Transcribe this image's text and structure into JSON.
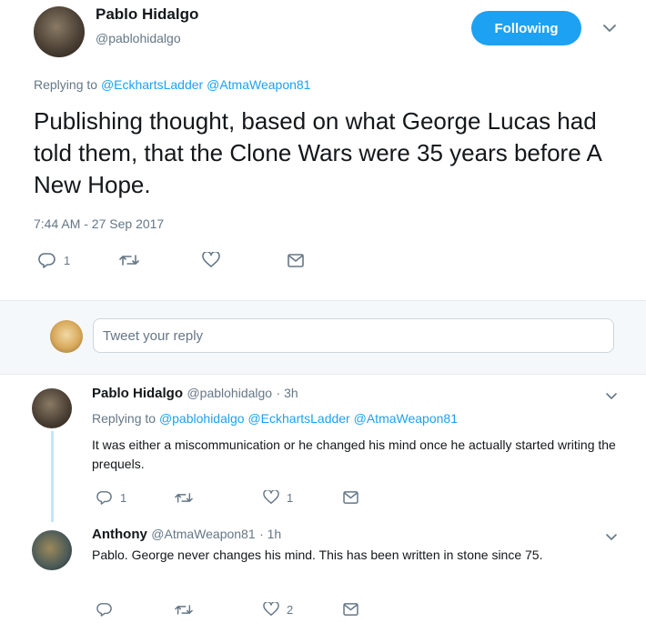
{
  "main_tweet": {
    "author_name": "Pablo Hidalgo",
    "author_handle": "@pablohidalgo",
    "follow_label": "Following",
    "replying_prefix": "Replying to",
    "replying_to": [
      "@EckhartsLadder",
      "@AtmaWeapon81"
    ],
    "text": "Publishing thought, based on what George Lucas had told them, that the Clone Wars were 35 years before A New Hope.",
    "timestamp": "7:44 AM - 27 Sep 2017",
    "reply_count": "1"
  },
  "composer": {
    "placeholder": "Tweet your reply"
  },
  "replies": [
    {
      "author_name": "Pablo Hidalgo",
      "author_handle": "@pablohidalgo",
      "age": "· 3h",
      "replying_prefix": "Replying to",
      "replying_to": [
        "@pablohidalgo",
        "@EckhartsLadder",
        "@AtmaWeapon81"
      ],
      "text": "It was either a miscommunication or he changed his mind once he actually started writing the prequels.",
      "reply_count": "1",
      "like_count": "1"
    },
    {
      "author_name": "Anthony",
      "author_handle": "@AtmaWeapon81",
      "age": "· 1h",
      "text": "Pablo. George never changes his mind. This has been written in stone since 75.",
      "like_count": "2"
    }
  ],
  "colors": {
    "accent": "#1da1f2",
    "muted": "#657786",
    "band": "#f5f8fa"
  },
  "icons": [
    "reply-icon",
    "retweet-icon",
    "heart-icon",
    "direct-message-icon",
    "chevron-down-icon"
  ]
}
